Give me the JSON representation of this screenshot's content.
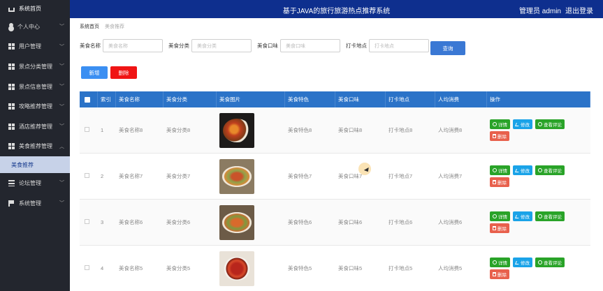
{
  "header": {
    "title": "基于JAVA的旅行旅游热点推荐系统",
    "user": "管理员 admin",
    "logout": "退出登录"
  },
  "sidebar": {
    "home": "系统首页",
    "items": [
      {
        "label": "个人中心",
        "icon": "user-icon"
      },
      {
        "label": "用户管理",
        "icon": "grid-icon"
      },
      {
        "label": "景点分类管理",
        "icon": "grid-icon"
      },
      {
        "label": "景点信息管理",
        "icon": "grid-icon"
      },
      {
        "label": "攻略推荐管理",
        "icon": "grid-icon"
      },
      {
        "label": "酒店推荐管理",
        "icon": "grid-icon"
      },
      {
        "label": "美食推荐管理",
        "icon": "grid-icon",
        "expanded": true
      }
    ],
    "sub_item": "美食推荐",
    "after": [
      {
        "label": "论坛管理",
        "icon": "menu-icon"
      },
      {
        "label": "系统管理",
        "icon": "flag-icon"
      }
    ]
  },
  "breadcrumb": {
    "home": "系统首页",
    "current": "美食推荐"
  },
  "search": {
    "fields": [
      {
        "label": "美食名称",
        "placeholder": "美食名称"
      },
      {
        "label": "美食分类",
        "placeholder": "美食分类"
      },
      {
        "label": "美食口味",
        "placeholder": "美食口味"
      },
      {
        "label": "打卡地点",
        "placeholder": "打卡地点"
      }
    ],
    "button": "查询"
  },
  "actions": {
    "add": "新增",
    "delete": "删除"
  },
  "table": {
    "columns": [
      "索引",
      "美食名称",
      "美食分类",
      "美食图片",
      "美食特色",
      "美食口味",
      "打卡地点",
      "人均消费",
      "操作"
    ],
    "rows": [
      {
        "index": "1",
        "name": "美食名称8",
        "category": "美食分类8",
        "feature": "美食特色8",
        "taste": "美食口味8",
        "place": "打卡地点8",
        "price": "人均消费8"
      },
      {
        "index": "2",
        "name": "美食名称7",
        "category": "美食分类7",
        "feature": "美食特色7",
        "taste": "美食口味7",
        "place": "打卡地点7",
        "price": "人均消费7"
      },
      {
        "index": "3",
        "name": "美食名称6",
        "category": "美食分类6",
        "feature": "美食特色6",
        "taste": "美食口味6",
        "place": "打卡地点6",
        "price": "人均消费6"
      },
      {
        "index": "4",
        "name": "美食名称5",
        "category": "美食分类5",
        "feature": "美食特色5",
        "taste": "美食口味5",
        "place": "打卡地点5",
        "price": "人均消费5"
      }
    ],
    "row_actions": {
      "detail": "详情",
      "edit": "修改",
      "review": "查看评论",
      "delete": "删除"
    }
  },
  "colors": {
    "header_bg": "#0e2f8e",
    "sidebar_bg": "#23262e",
    "table_head": "#2b73c8",
    "green": "#29a328",
    "blue": "#1aa3e8",
    "red": "#f01414"
  }
}
